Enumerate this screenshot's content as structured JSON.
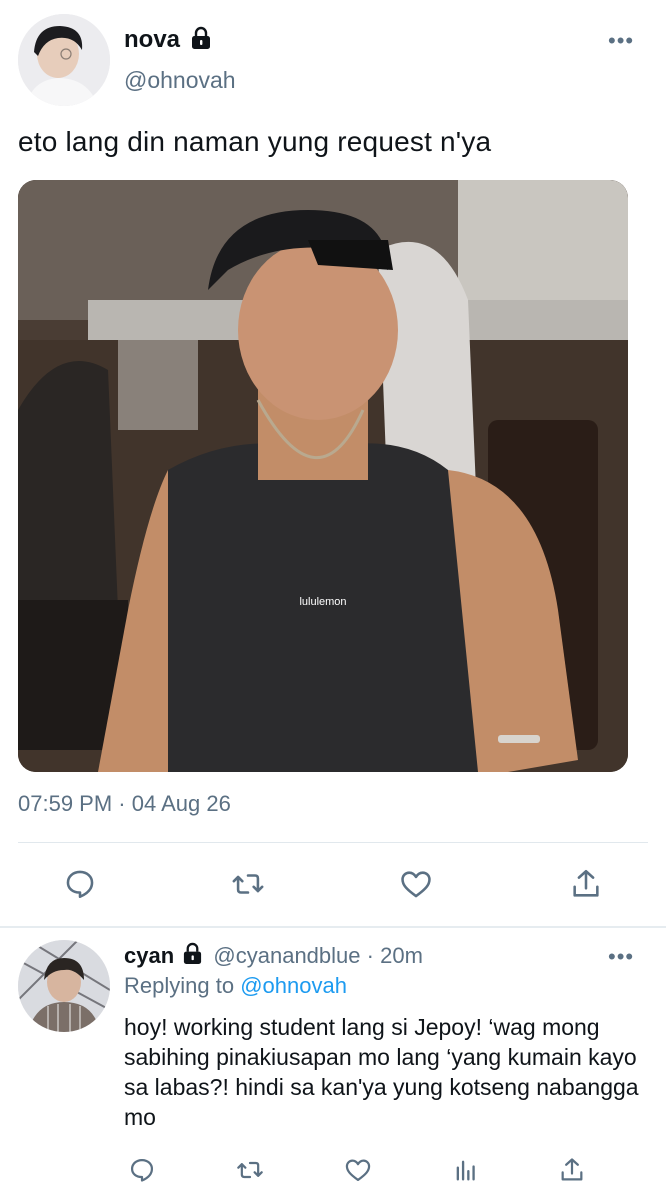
{
  "tweet": {
    "author": {
      "name": "nova",
      "handle": "@ohnovah",
      "protected": true
    },
    "text": "eto lang din naman yung request n'ya",
    "timestamp": "07:59 PM · 04 Aug 26",
    "media": {
      "description_icon": "photo-icon",
      "shirt_print": "lululemon"
    },
    "actions": [
      "reply-icon",
      "retweet-icon",
      "like-icon",
      "share-icon"
    ],
    "more": "•••"
  },
  "reply": {
    "author": {
      "name": "cyan",
      "handle": "@cyanandblue",
      "protected": true
    },
    "separator": "·",
    "age": "20m",
    "replying_prefix": "Replying to",
    "replying_to": "@ohnovah",
    "text": "hoy! working student lang si Jepoy! ‘wag mong sabihing pinakiusapan mo lang ‘yang kumain kayo sa labas?! hindi sa kan'ya yung kotseng nabangga mo",
    "actions": [
      "reply-icon",
      "retweet-icon",
      "like-icon",
      "analytics-icon",
      "share-icon"
    ],
    "more": "•••"
  },
  "colors": {
    "text": "#0f1419",
    "secondary": "#5b7083",
    "link": "#1d9bf0",
    "divider": "#e1e8ed"
  }
}
